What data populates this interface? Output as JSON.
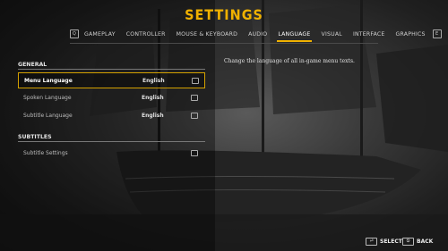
{
  "title": "SETTINGS",
  "tab_nav": {
    "prev_key": "Q",
    "next_key": "E"
  },
  "tabs": [
    {
      "label": "GAMEPLAY",
      "active": false
    },
    {
      "label": "CONTROLLER",
      "active": false
    },
    {
      "label": "MOUSE & KEYBOARD",
      "active": false
    },
    {
      "label": "AUDIO",
      "active": false
    },
    {
      "label": "LANGUAGE",
      "active": true
    },
    {
      "label": "VISUAL",
      "active": false
    },
    {
      "label": "INTERFACE",
      "active": false
    },
    {
      "label": "GRAPHICS",
      "active": false
    }
  ],
  "sections": {
    "general": "GENERAL",
    "subtitles": "SUBTITLES"
  },
  "rows": [
    {
      "label": "Menu Language",
      "value": "English",
      "selected": true
    },
    {
      "label": "Spoken Language",
      "value": "English",
      "selected": false
    },
    {
      "label": "Subtitle Language",
      "value": "English",
      "selected": false
    },
    {
      "label": "Subtitle Settings",
      "value": "",
      "selected": false
    }
  ],
  "description": "Change the language of all in-game menu texts.",
  "footer": {
    "select_label": "SELECT",
    "back_label": "BACK"
  },
  "colors": {
    "accent": "#f0b100"
  }
}
